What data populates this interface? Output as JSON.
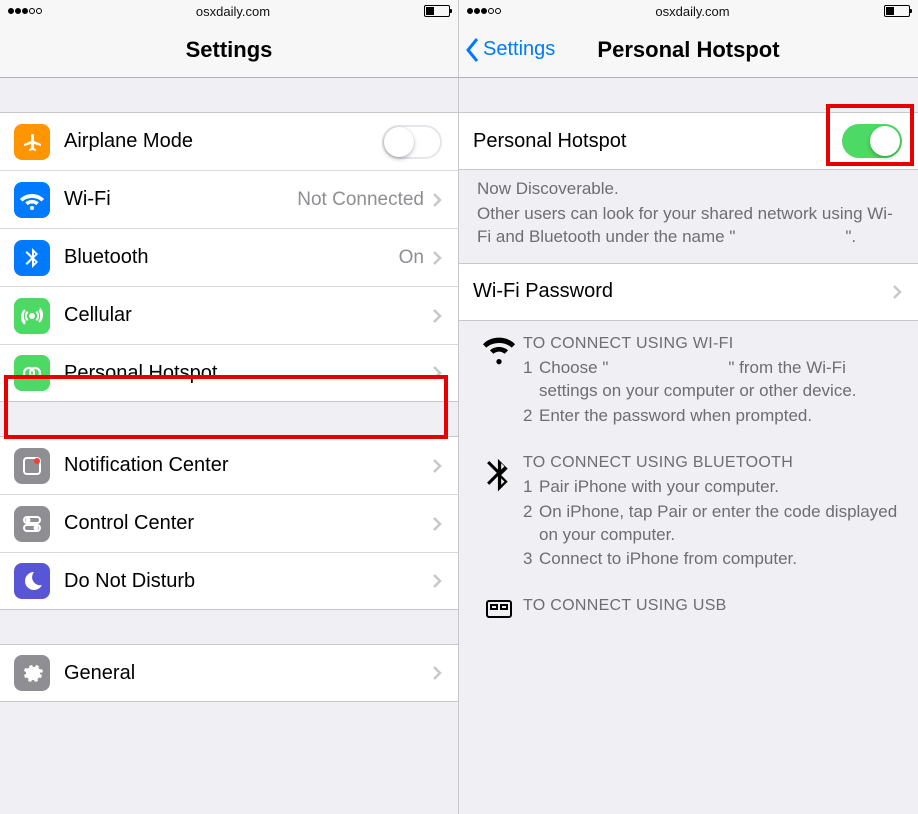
{
  "status": {
    "domain": "osxdaily.com"
  },
  "left": {
    "title": "Settings",
    "items": {
      "airplane": {
        "label": "Airplane Mode"
      },
      "wifi": {
        "label": "Wi-Fi",
        "value": "Not Connected"
      },
      "bluetooth": {
        "label": "Bluetooth",
        "value": "On"
      },
      "cellular": {
        "label": "Cellular"
      },
      "hotspot": {
        "label": "Personal Hotspot"
      },
      "notif": {
        "label": "Notification Center"
      },
      "control": {
        "label": "Control Center"
      },
      "dnd": {
        "label": "Do Not Disturb"
      },
      "general": {
        "label": "General"
      }
    }
  },
  "right": {
    "back": "Settings",
    "title": "Personal Hotspot",
    "toggle_label": "Personal Hotspot",
    "discoverable_title": "Now Discoverable.",
    "discoverable_body_a": "Other users can look for your shared network using Wi-Fi and Bluetooth under the name \"",
    "discoverable_body_b": "\".",
    "wifi_password": "Wi-Fi Password",
    "instr_wifi": {
      "title": "TO CONNECT USING WI-FI",
      "s1a": "Choose \"",
      "s1b": "\" from the Wi-Fi settings on your computer or other device.",
      "s2": "Enter the password when prompted."
    },
    "instr_bt": {
      "title": "TO CONNECT USING BLUETOOTH",
      "s1": "Pair iPhone with your computer.",
      "s2": "On iPhone, tap Pair or enter the code displayed on your computer.",
      "s3": "Connect to iPhone from computer."
    },
    "instr_usb": {
      "title": "TO CONNECT USING USB"
    }
  }
}
